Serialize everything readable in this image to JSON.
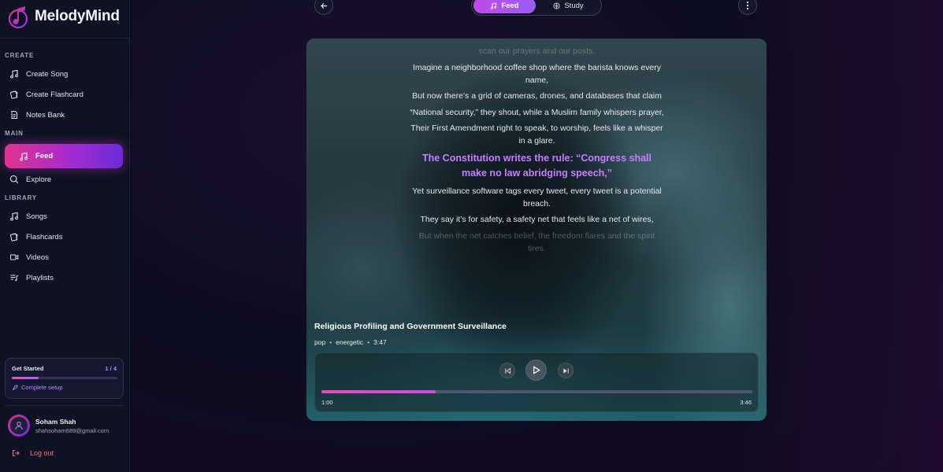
{
  "brand": {
    "name": "MelodyMind"
  },
  "sidebar": {
    "sections": {
      "create": "CREATE",
      "main": "MAIN",
      "library": "LIBRARY"
    },
    "create_items": [
      {
        "label": "Create Song",
        "icon": "music-note-icon"
      },
      {
        "label": "Create Flashcard",
        "icon": "flashcard-icon"
      },
      {
        "label": "Notes Bank",
        "icon": "document-icon"
      }
    ],
    "main_items": [
      {
        "label": "Feed",
        "icon": "music-note-icon",
        "active": true
      },
      {
        "label": "Explore",
        "icon": "search-icon"
      }
    ],
    "library_items": [
      {
        "label": "Songs",
        "icon": "music-note-icon"
      },
      {
        "label": "Flashcards",
        "icon": "flashcard-icon"
      },
      {
        "label": "Videos",
        "icon": "video-icon"
      },
      {
        "label": "Playlists",
        "icon": "playlist-icon"
      }
    ],
    "get_started": {
      "title": "Get Started",
      "count": "1 / 4",
      "progress": 0.25,
      "link": "Complete setup"
    },
    "user": {
      "name": "Soham Shah",
      "email": "shahsoham689@gmail.com"
    },
    "logout": "Log out"
  },
  "header": {
    "tabs": [
      {
        "label": "Feed",
        "active": true
      },
      {
        "label": "Study",
        "active": false
      }
    ]
  },
  "player": {
    "lyrics": [
      {
        "text": "scan our prayers and our posts.",
        "state": "fade"
      },
      {
        "text": "Imagine a neighborhood coffee shop where the barista knows every name,",
        "state": "normal"
      },
      {
        "text": "But now there’s a grid of cameras, drones, and databases that claim",
        "state": "normal"
      },
      {
        "text": "“National security,” they shout, while a Muslim family whispers prayer,",
        "state": "normal"
      },
      {
        "text": "Their First Amendment right to speak, to worship, feels like a whisper in a glare.",
        "state": "normal"
      },
      {
        "text": "The Constitution writes the rule: “Congress shall make no law abridging speech,”",
        "state": "current"
      },
      {
        "text": "Yet surveillance software tags every tweet, every tweet is a potential breach.",
        "state": "normal"
      },
      {
        "text": "They say it’s for safety, a safety net that feels like a net of wires,",
        "state": "normal"
      },
      {
        "text": "But when the net catches belief, the freedom flares and the spirit tires.",
        "state": "fade"
      }
    ],
    "song": {
      "title": "Religious Profiling and Government Surveillance",
      "genre": "pop",
      "mood": "energetic",
      "duration": "3:47"
    },
    "progress": 0.265,
    "time_current": "1:00",
    "time_total": "3:46"
  },
  "colors": {
    "accent_pink": "#e0338f",
    "accent_purple": "#9b5cf5",
    "lyric_highlight": "#c77dff",
    "logout_red": "#ff6b7a"
  }
}
